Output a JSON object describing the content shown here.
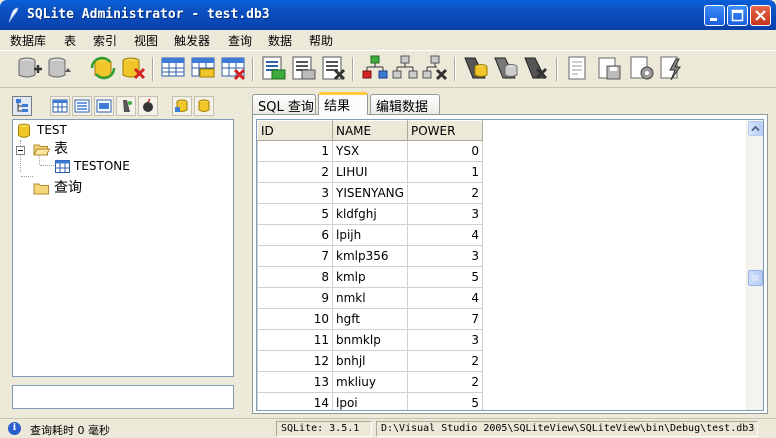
{
  "window": {
    "title": "SQLite Administrator - test.db3"
  },
  "menu": [
    "数据库",
    "表",
    "索引",
    "视图",
    "触发器",
    "查询",
    "数据",
    "帮助"
  ],
  "toolbar_icons": [
    "new-database-icon",
    "open-database-icon",
    "refresh-icon",
    "close-database-icon",
    "table-icon",
    "table-edit-icon",
    "table-delete-icon",
    "index-new-icon",
    "index-edit-icon",
    "index-delete-icon",
    "view-new-icon",
    "view-edit-icon",
    "view-delete-icon",
    "trigger-new-icon",
    "trigger-edit-icon",
    "trigger-delete-icon",
    "query-icon",
    "save-icon",
    "execute-icon",
    "lightning-icon"
  ],
  "tree": {
    "root": "TEST",
    "tables_folder": "表",
    "table": "TESTONE",
    "queries_folder": "查询"
  },
  "tabs": [
    "SQL 查询",
    "结果",
    "编辑数据"
  ],
  "active_tab": "结果",
  "grid": {
    "columns": [
      "ID",
      "NAME",
      "POWER"
    ],
    "rows": [
      [
        "1",
        "YSX",
        "0"
      ],
      [
        "2",
        "LIHUI",
        "1"
      ],
      [
        "3",
        "YISENYANG",
        "2"
      ],
      [
        "5",
        "kldfghj",
        "3"
      ],
      [
        "6",
        "lpijh",
        "4"
      ],
      [
        "7",
        "kmlp356",
        "3"
      ],
      [
        "8",
        "kmlp",
        "5"
      ],
      [
        "9",
        "nmkl",
        "4"
      ],
      [
        "10",
        "hgft",
        "7"
      ],
      [
        "11",
        "bnmklp",
        "3"
      ],
      [
        "12",
        "bnhjl",
        "2"
      ],
      [
        "13",
        "mkliuy",
        "2"
      ],
      [
        "14",
        "lpoi",
        "5"
      ]
    ]
  },
  "status": {
    "query_time": "查询耗时 0 毫秒",
    "version": "SQLite: 3.5.1",
    "path": "D:\\Visual Studio 2005\\SQLiteView\\SQLiteView\\bin\\Debug\\test.db3"
  }
}
